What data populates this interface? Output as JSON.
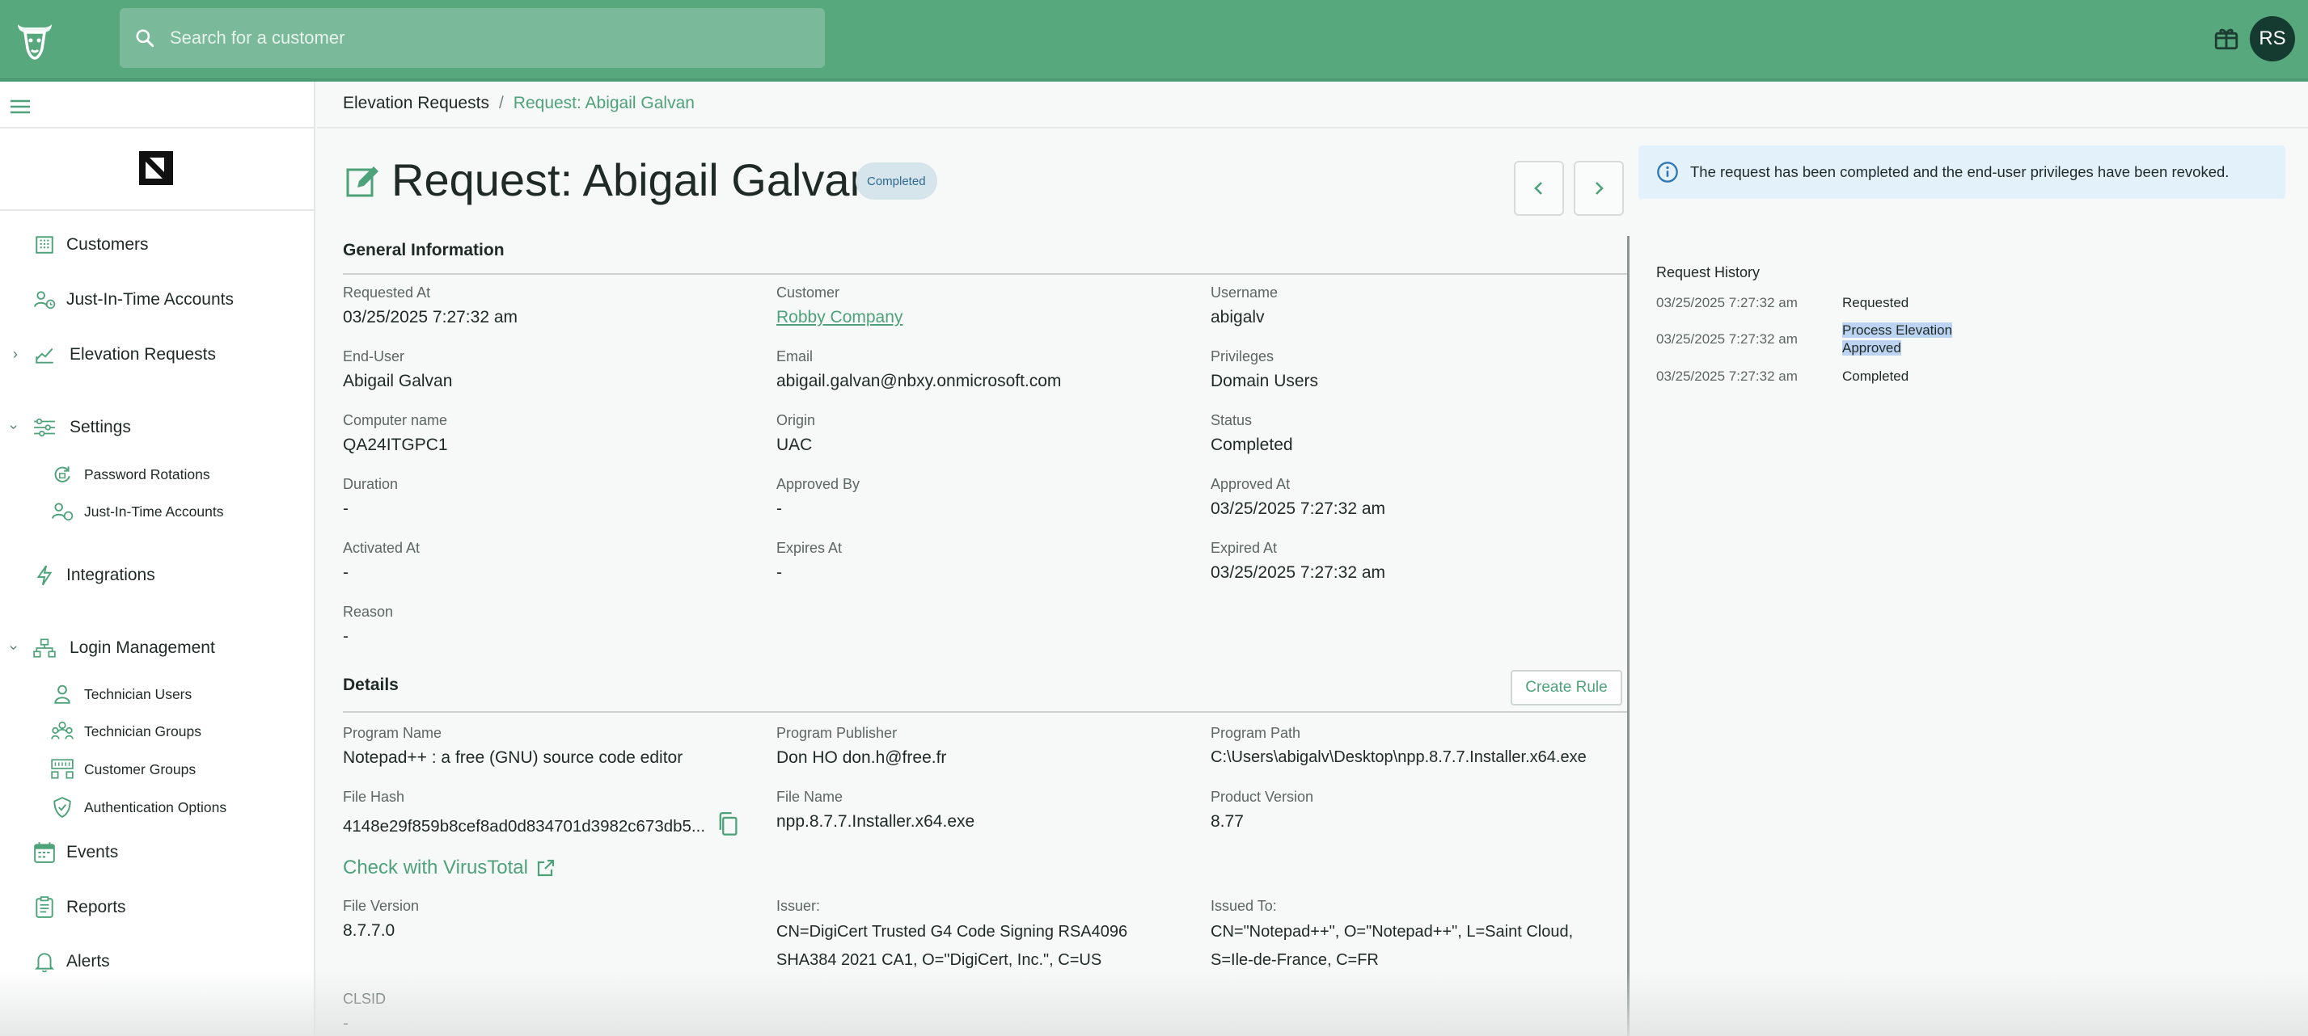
{
  "topbar": {
    "search_placeholder": "Search for a customer",
    "avatar_initials": "RS"
  },
  "sidebar": {
    "items": [
      {
        "label": "Customers",
        "icon": "building-icon"
      },
      {
        "label": "Just-In-Time Accounts",
        "icon": "user-clock-icon"
      },
      {
        "label": "Elevation Requests",
        "icon": "elevation-chart-icon"
      },
      {
        "label": "Settings",
        "icon": "sliders-icon"
      },
      {
        "label": "Password Rotations",
        "icon": "rotation-icon"
      },
      {
        "label": "Just-In-Time Accounts",
        "icon": "user-clock-icon"
      },
      {
        "label": "Integrations",
        "icon": "bolt-icon"
      },
      {
        "label": "Login Management",
        "icon": "hierarchy-icon"
      },
      {
        "label": "Technician Users",
        "icon": "user-icon"
      },
      {
        "label": "Technician Groups",
        "icon": "users-group-icon"
      },
      {
        "label": "Customer Groups",
        "icon": "org-icon"
      },
      {
        "label": "Authentication Options",
        "icon": "shield-check-icon"
      },
      {
        "label": "Events",
        "icon": "calendar-icon"
      },
      {
        "label": "Reports",
        "icon": "clipboard-icon"
      },
      {
        "label": "Alerts",
        "icon": "bell-icon"
      }
    ]
  },
  "breadcrumb": {
    "parent": "Elevation Requests",
    "separator": "/",
    "current": "Request: Abigail Galvan"
  },
  "header": {
    "title": "Request: Abigail Galvan",
    "status_badge": "Completed"
  },
  "alert": {
    "text": "The request has been completed and the end-user privileges have been revoked."
  },
  "general": {
    "heading": "General Information",
    "fields": [
      {
        "label": "Requested At",
        "value": "03/25/2025 7:27:32 am"
      },
      {
        "label": "Customer",
        "value": "Robby Company"
      },
      {
        "label": "Username",
        "value": "abigalv"
      },
      {
        "label": "End-User",
        "value": "Abigail Galvan"
      },
      {
        "label": "Email",
        "value": "abigail.galvan@nbxy.onmicrosoft.com"
      },
      {
        "label": "Privileges",
        "value": "Domain Users"
      },
      {
        "label": "Computer name",
        "value": "QA24ITGPC1"
      },
      {
        "label": "Origin",
        "value": "UAC"
      },
      {
        "label": "Status",
        "value": "Completed"
      },
      {
        "label": "Duration",
        "value": "-"
      },
      {
        "label": "Approved By",
        "value": "-"
      },
      {
        "label": "Approved At",
        "value": "03/25/2025 7:27:32 am"
      },
      {
        "label": "Activated At",
        "value": "-"
      },
      {
        "label": "Expires At",
        "value": "-"
      },
      {
        "label": "Expired At",
        "value": "03/25/2025 7:27:32 am"
      },
      {
        "label": "Reason",
        "value": "-"
      }
    ]
  },
  "details": {
    "heading": "Details",
    "create_rule": "Create Rule",
    "fields": [
      {
        "label": "Program Name",
        "value": "Notepad++ : a free (GNU) source code editor"
      },
      {
        "label": "Program Publisher",
        "value": "Don HO don.h@free.fr"
      },
      {
        "label": "Program Path",
        "value": "C:\\Users\\abigalv\\Desktop\\npp.8.7.7.Installer.x64.exe"
      },
      {
        "label": "File Hash",
        "value": "4148e29f859b8cef8ad0d834701d3982c673db5..."
      },
      {
        "label": "File Name",
        "value": "npp.8.7.7.Installer.x64.exe"
      },
      {
        "label": "Product Version",
        "value": "8.77"
      },
      {
        "label": "File Version",
        "value": "8.7.7.0"
      },
      {
        "label": "Issuer:",
        "value_lines": [
          "CN=DigiCert Trusted G4 Code Signing RSA4096",
          "SHA384 2021 CA1, O=\"DigiCert, Inc.\", C=US"
        ]
      },
      {
        "label": "Issued To:",
        "value_lines": [
          "CN=\"Notepad++\", O=\"Notepad++\", L=Saint Cloud,",
          "S=Ile-de-France, C=FR"
        ]
      },
      {
        "label": "CLSID",
        "value": "-"
      }
    ],
    "virustotal_link": "Check with VirusTotal"
  },
  "history": {
    "title": "Request History",
    "rows": [
      {
        "date": "03/25/2025 7:27:32 am",
        "event_lines": [
          "Requested"
        ]
      },
      {
        "date": "03/25/2025 7:27:32 am",
        "event_lines": [
          "Process Elevation",
          "Approved"
        ]
      },
      {
        "date": "03/25/2025 7:27:32 am",
        "event_lines": [
          "Completed"
        ]
      }
    ]
  },
  "colors": {
    "brand_green": "#58a87e",
    "accent_green": "#4ea27a",
    "badge_bg": "#d6e4ec",
    "alert_bg": "#e3f1fb"
  }
}
